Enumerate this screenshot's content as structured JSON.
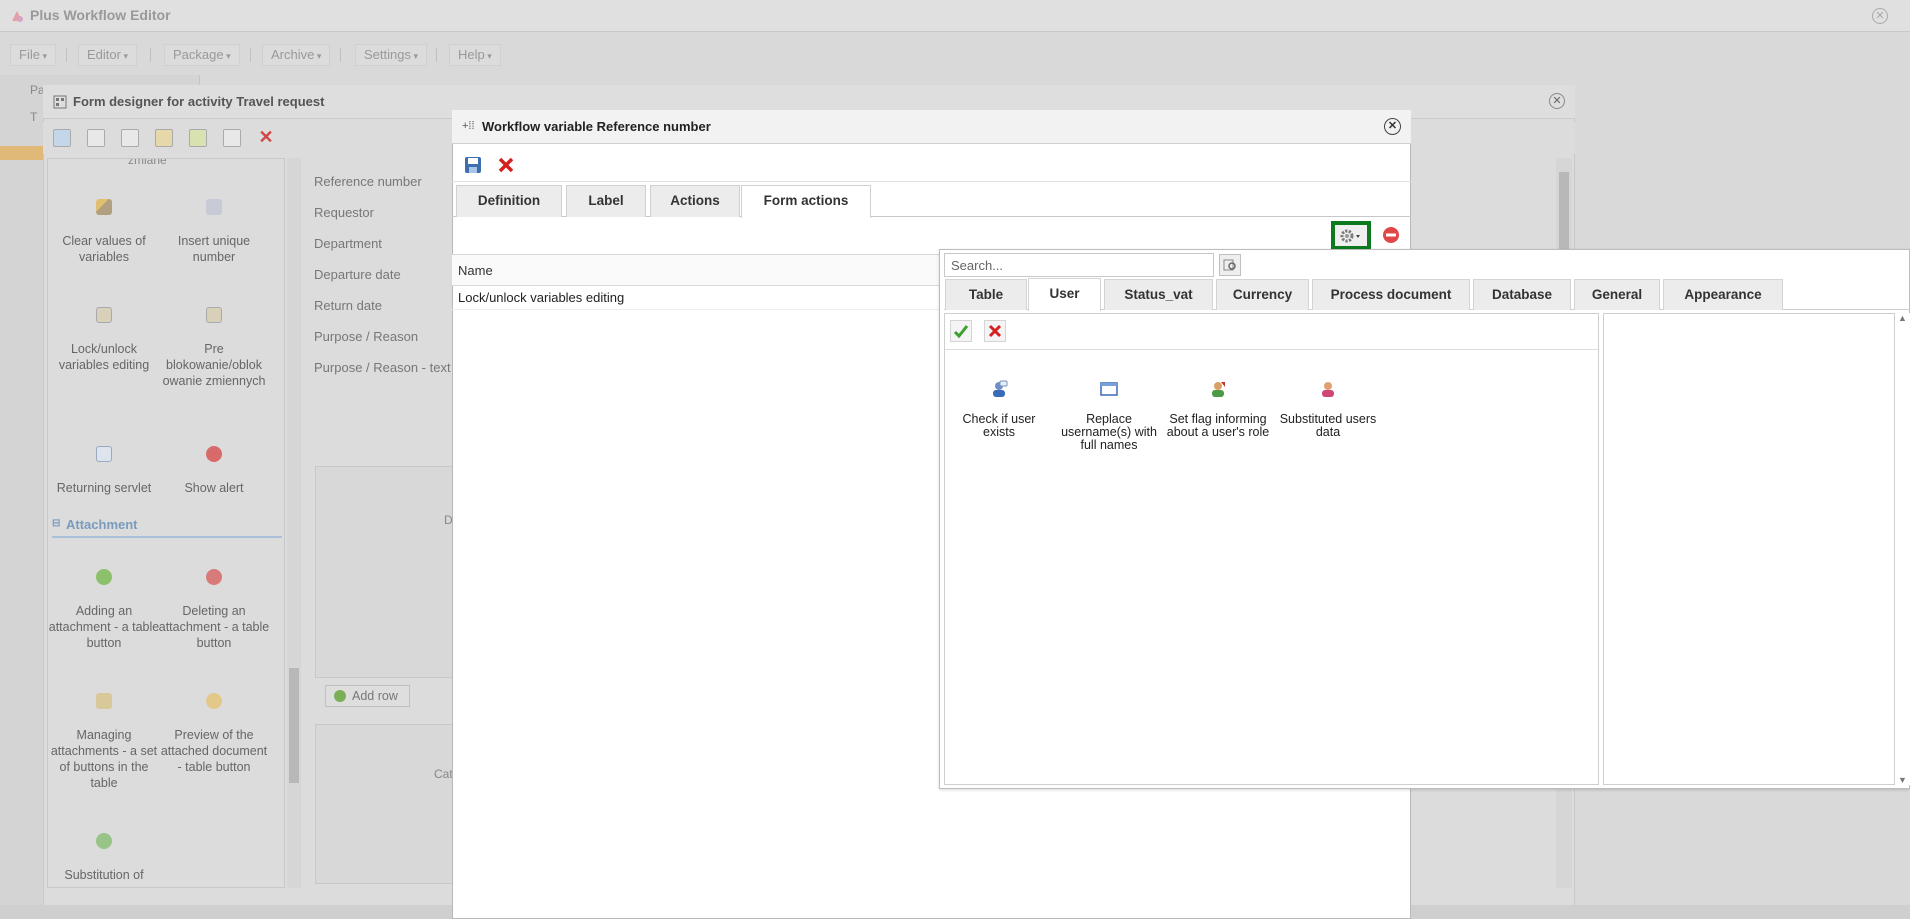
{
  "app": {
    "title": "Plus Workflow Editor",
    "menu": [
      "File",
      "Editor",
      "Package",
      "Archive",
      "Settings",
      "Help"
    ],
    "left_tree_fragments": [
      "Pa",
      "T"
    ]
  },
  "form_designer": {
    "title": "Form designer for activity Travel request",
    "palette_top_cut": "zmiane",
    "palette_items": [
      {
        "label": "Clear values of variables",
        "icon": "wand-icon"
      },
      {
        "label": "Insert unique number",
        "icon": "tag-icon"
      },
      {
        "label": "Lock/unlock variables editing",
        "icon": "lock-form-icon"
      },
      {
        "label": "Pre blokowanie/oblok owanie zmiennych",
        "icon": "lock-form-icon"
      },
      {
        "label": "Returning servlet",
        "icon": "form-icon"
      },
      {
        "label": "Show alert",
        "icon": "alert-icon"
      }
    ],
    "section_title": "Attachment",
    "attachment_items": [
      {
        "label": "Adding an attachment - a table button",
        "icon": "add-icon"
      },
      {
        "label": "Deleting an attachment - a table button",
        "icon": "remove-icon"
      },
      {
        "label": "Managing attachments - a set of buttons in the table",
        "icon": "paperclip-icon"
      },
      {
        "label": "Preview of the attached document - table button",
        "icon": "magnifier-icon"
      },
      {
        "label": "Substitution of",
        "icon": "refresh-icon"
      }
    ],
    "fields": [
      "Reference number",
      "Requestor",
      "Department",
      "Departure date",
      "Return date",
      "Purpose / Reason",
      "Purpose / Reason - text"
    ],
    "grid1_col": "D",
    "grid2_col": "Cat",
    "add_row_label": "Add row"
  },
  "dialog": {
    "title": "Workflow variable Reference number",
    "tabs": [
      "Definition",
      "Label",
      "Actions",
      "Form actions"
    ],
    "active_tab": "Form actions",
    "table": {
      "column": "Name",
      "rows": [
        "Lock/unlock variables editing"
      ]
    }
  },
  "popup": {
    "search_placeholder": "Search...",
    "tabs": [
      "Table",
      "User",
      "Status_vat",
      "Currency",
      "Process document",
      "Database",
      "General",
      "Appearance"
    ],
    "active_tab": "User",
    "actions": [
      {
        "label": "Check if user exists",
        "icon": "user-check-icon"
      },
      {
        "label": "Replace username(s) with full names",
        "icon": "window-icon"
      },
      {
        "label": "Set flag informing about a user's role",
        "icon": "user-role-icon"
      },
      {
        "label": "Substituted users data",
        "icon": "user-icon"
      }
    ]
  },
  "colors": {
    "highlight_border": "#0d7a1d",
    "section_title": "#7a9bbd",
    "ok_green": "#3aa12f",
    "cancel_red": "#d32020"
  }
}
